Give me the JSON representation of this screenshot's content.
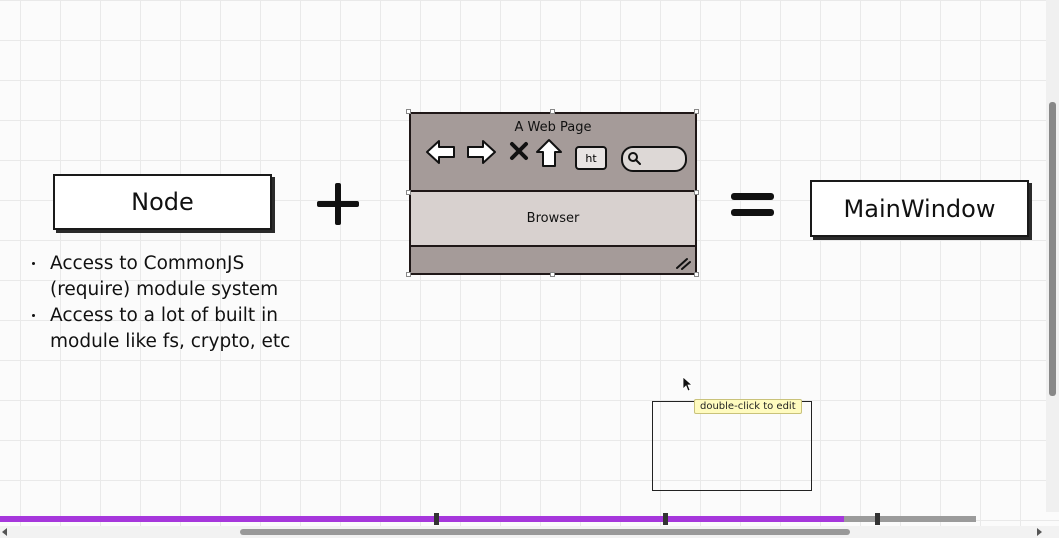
{
  "canvas": {
    "node_box": {
      "label": "Node"
    },
    "bullets": [
      "Access to CommonJS (require) module system",
      "Access to a lot of built in module like fs, crypto, etc"
    ],
    "plus_symbol": "+",
    "browser_mockup": {
      "title": "A Web Page",
      "content_label": "Browser",
      "url_field_text": "ht",
      "toolbar_icons": [
        "back-arrow-icon",
        "forward-arrow-icon",
        "stop-icon",
        "home-icon",
        "url-field-icon",
        "search-icon"
      ]
    },
    "equals_symbol": "=",
    "result_box": {
      "label": "MainWindow"
    },
    "empty_box": {},
    "tooltip": {
      "text": "double-click to edit"
    }
  },
  "timeline": {
    "progress_fraction": 0.865,
    "accent_color": "#a637dc"
  },
  "scrollbars": {
    "horizontal": true,
    "vertical": true
  }
}
